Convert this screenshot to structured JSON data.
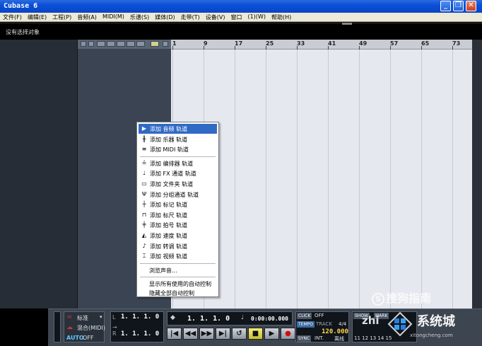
{
  "window": {
    "title": "Cubase 6"
  },
  "menu": [
    "文件(F)",
    "编辑(E)",
    "工程(P)",
    "音频(A)",
    "MIDI(M)",
    "乐谱(S)",
    "媒体(D)",
    "走带(T)",
    "设备(V)",
    "窗口",
    "(1)(W)",
    "帮助(H)"
  ],
  "info_line": "没有选择对象",
  "ruler": {
    "bars": [
      "1",
      "9",
      "17",
      "25",
      "33",
      "41",
      "49",
      "57",
      "65",
      "73"
    ]
  },
  "context_menu": {
    "group1": [
      {
        "icon": "▶",
        "label": "添加 音频 轨道",
        "highlighted": true
      },
      {
        "icon": "╫",
        "label": "添加 乐器 轨道"
      },
      {
        "icon": "≡",
        "label": "添加 MIDI 轨道"
      }
    ],
    "group2": [
      {
        "icon": "≟",
        "label": "添加 编排器 轨道"
      },
      {
        "icon": "♩",
        "label": "添加 FX 通道 轨道"
      },
      {
        "icon": "▭",
        "label": "添加 文件夹 轨道"
      },
      {
        "icon": "Ψ",
        "label": "添加 分组通道 轨道"
      },
      {
        "icon": "┼",
        "label": "添加 标记 轨道"
      },
      {
        "icon": "⊓",
        "label": "添加 标尺 轨道"
      },
      {
        "icon": "╪",
        "label": "添加 拍号 轨道"
      },
      {
        "icon": "◭",
        "label": "添加 速度 轨道"
      },
      {
        "icon": "♪",
        "label": "添加 转调 轨道"
      },
      {
        "icon": "⌶",
        "label": "添加 视频 轨道"
      }
    ],
    "browse": "浏览声音...",
    "auto_show": "显示所有使用的自动控制",
    "auto_hide": "隐藏全部自动控制"
  },
  "transport": {
    "mode": "标准",
    "mix": "混合(MIDI)",
    "auto": "AUTO",
    "auto_state": "OFF",
    "left_loc": "1. 1. 1.   0",
    "right_loc": "1. 1. 1.   0",
    "main_pos": "1. 1. 1.   0",
    "time": "0:00:00.000",
    "click_label": "CLICK",
    "click_state": "OFF",
    "tempo_label": "TEMPO",
    "track_label": "TRACK",
    "signature": "4/4",
    "tempo_value": "120.000",
    "sync_label": "SYNC",
    "sync_state": "INT.",
    "sync_extra": "离线",
    "show_label": "SHOW",
    "mark_label": "MARK",
    "small_digits": "11 12 13 14 15"
  },
  "watermarks": {
    "sogou": "搜狗指南",
    "zhi": "zhi",
    "brand": "系统城",
    "url": "xitongcheng.com"
  }
}
